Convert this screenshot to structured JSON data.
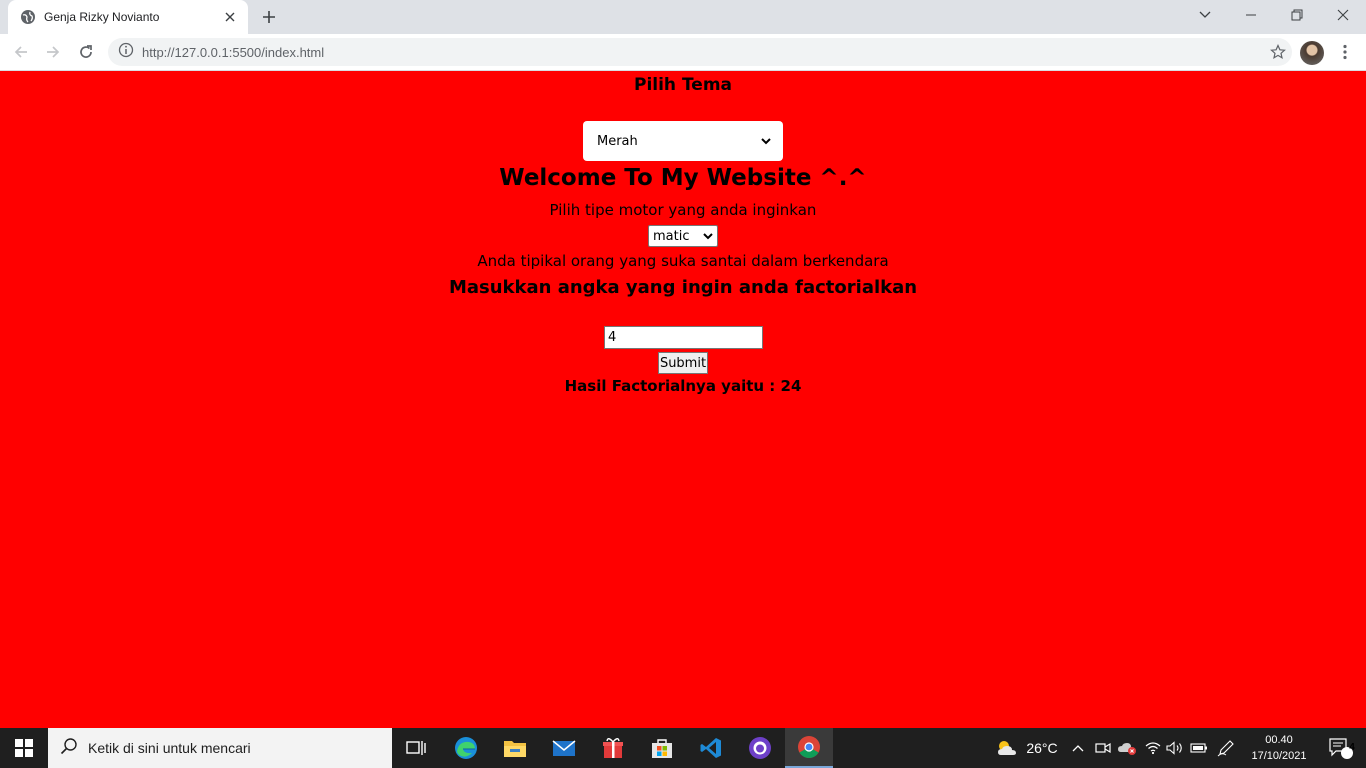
{
  "browser": {
    "tab_title": "Genja Rizky Novianto",
    "url": "http://127.0.0.1:5500/index.html"
  },
  "page": {
    "background_color": "#ff0000",
    "theme_title": "Pilih Tema",
    "theme_selected": "Merah",
    "welcome": "Welcome To My Website ^.^",
    "motor_label": "Pilih tipe motor yang anda inginkan",
    "motor_selected": "matic",
    "motor_result": "Anda tipikal orang yang suka santai dalam berkendara",
    "factorial_title": "Masukkan angka yang ingin anda factorialkan",
    "factorial_value": "4",
    "submit_label": "Submit",
    "result_text": "Hasil Factorialnya yaitu : 24"
  },
  "taskbar": {
    "search_placeholder": "Ketik di sini untuk mencari",
    "weather": "26°C",
    "time": "00.40",
    "date": "17/10/2021",
    "notification_count": "4",
    "apps": [
      "task-view",
      "edge",
      "file-explorer",
      "mail",
      "gift",
      "store",
      "vscode",
      "github-desktop",
      "chrome"
    ]
  }
}
